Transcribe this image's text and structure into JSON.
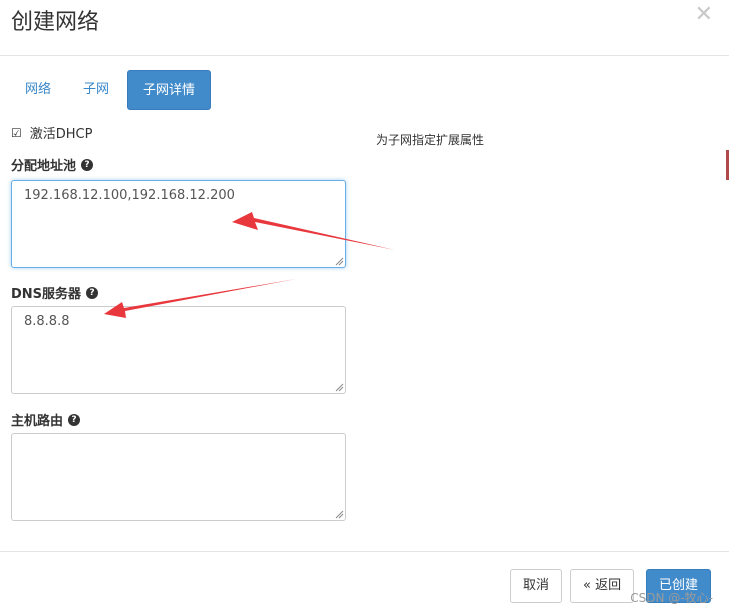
{
  "header": {
    "title": "创建网络",
    "close_glyph": "✕"
  },
  "tabs": [
    {
      "label": "网络",
      "active": false
    },
    {
      "label": "子网",
      "active": false
    },
    {
      "label": "子网详情",
      "active": true
    }
  ],
  "dhcp": {
    "label": "激活DHCP",
    "checked": true
  },
  "allocation_pool": {
    "label": "分配地址池",
    "value": "192.168.12.100,192.168.12.200"
  },
  "dns": {
    "label": "DNS服务器",
    "value": "8.8.8.8"
  },
  "host_routes": {
    "label": "主机路由",
    "value": ""
  },
  "side_help": "为子网指定扩展属性",
  "footer": {
    "cancel_label": "取消",
    "back_label": "« 返回",
    "create_label": "已创建"
  },
  "watermark": "CSDN @-牧心-",
  "colors": {
    "primary": "#428bca",
    "tab_link": "#3a87c8",
    "annotation_arrow": "#e8383d"
  }
}
